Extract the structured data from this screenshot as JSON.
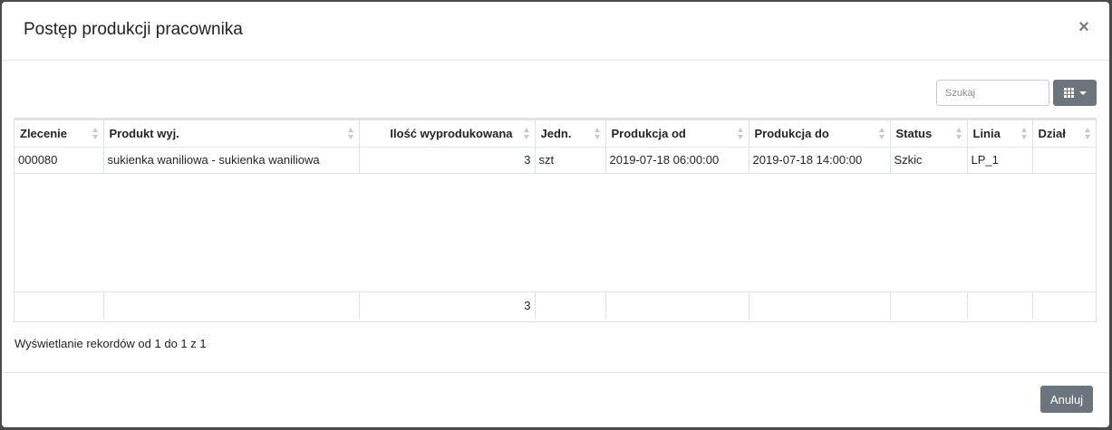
{
  "modal": {
    "title": "Postęp produkcji pracownika",
    "close_glyph": "×"
  },
  "toolbar": {
    "search_placeholder": "Szukaj",
    "columns_icon": "grid-icon"
  },
  "table": {
    "columns": [
      "Zlecenie",
      "Produkt wyj.",
      "Ilość wyprodukowana",
      "Jedn.",
      "Produkcja od",
      "Produkcja do",
      "Status",
      "Linia",
      "Dział"
    ],
    "rows": [
      {
        "zlecenie": "000080",
        "produkt": "sukienka waniliowa - sukienka waniliowa",
        "ilosc": "3",
        "jedn": "szt",
        "od": "2019-07-18 06:00:00",
        "do": "2019-07-18 14:00:00",
        "status": "Szkic",
        "linia": "LP_1",
        "dzial": ""
      }
    ],
    "footer": {
      "ilosc_total": "3"
    }
  },
  "pagination": {
    "info": "Wyświetlanie rekordów od 1 do 1 z 1"
  },
  "footer": {
    "cancel_label": "Anuluj"
  },
  "colors": {
    "button_gray": "#6c757d",
    "border": "#dee2e6"
  }
}
